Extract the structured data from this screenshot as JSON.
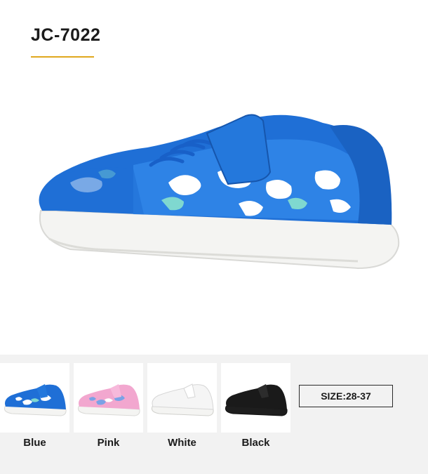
{
  "product": {
    "model": "JC-7022",
    "main_image": "blue-camo-sneaker"
  },
  "colors": [
    {
      "label": "Blue",
      "image": "blue-sneaker",
      "upper": "#1f6fd6",
      "camo": "#ffffff",
      "accent": "#7fd8d0"
    },
    {
      "label": "Pink",
      "image": "pink-sneaker",
      "upper": "#f2a7cf",
      "camo": "#7aa2e6",
      "accent": "#ffffff"
    },
    {
      "label": "White",
      "image": "white-sneaker",
      "upper": "#f5f5f5",
      "camo": "#e6e6e6",
      "accent": "#ffffff"
    },
    {
      "label": "Black",
      "image": "black-sneaker",
      "upper": "#1a1a1a",
      "camo": "#2c2c2c",
      "accent": "#3a3a3a"
    }
  ],
  "size": {
    "label": "SIZE:28-37"
  },
  "accent_color": "#e0a81e"
}
